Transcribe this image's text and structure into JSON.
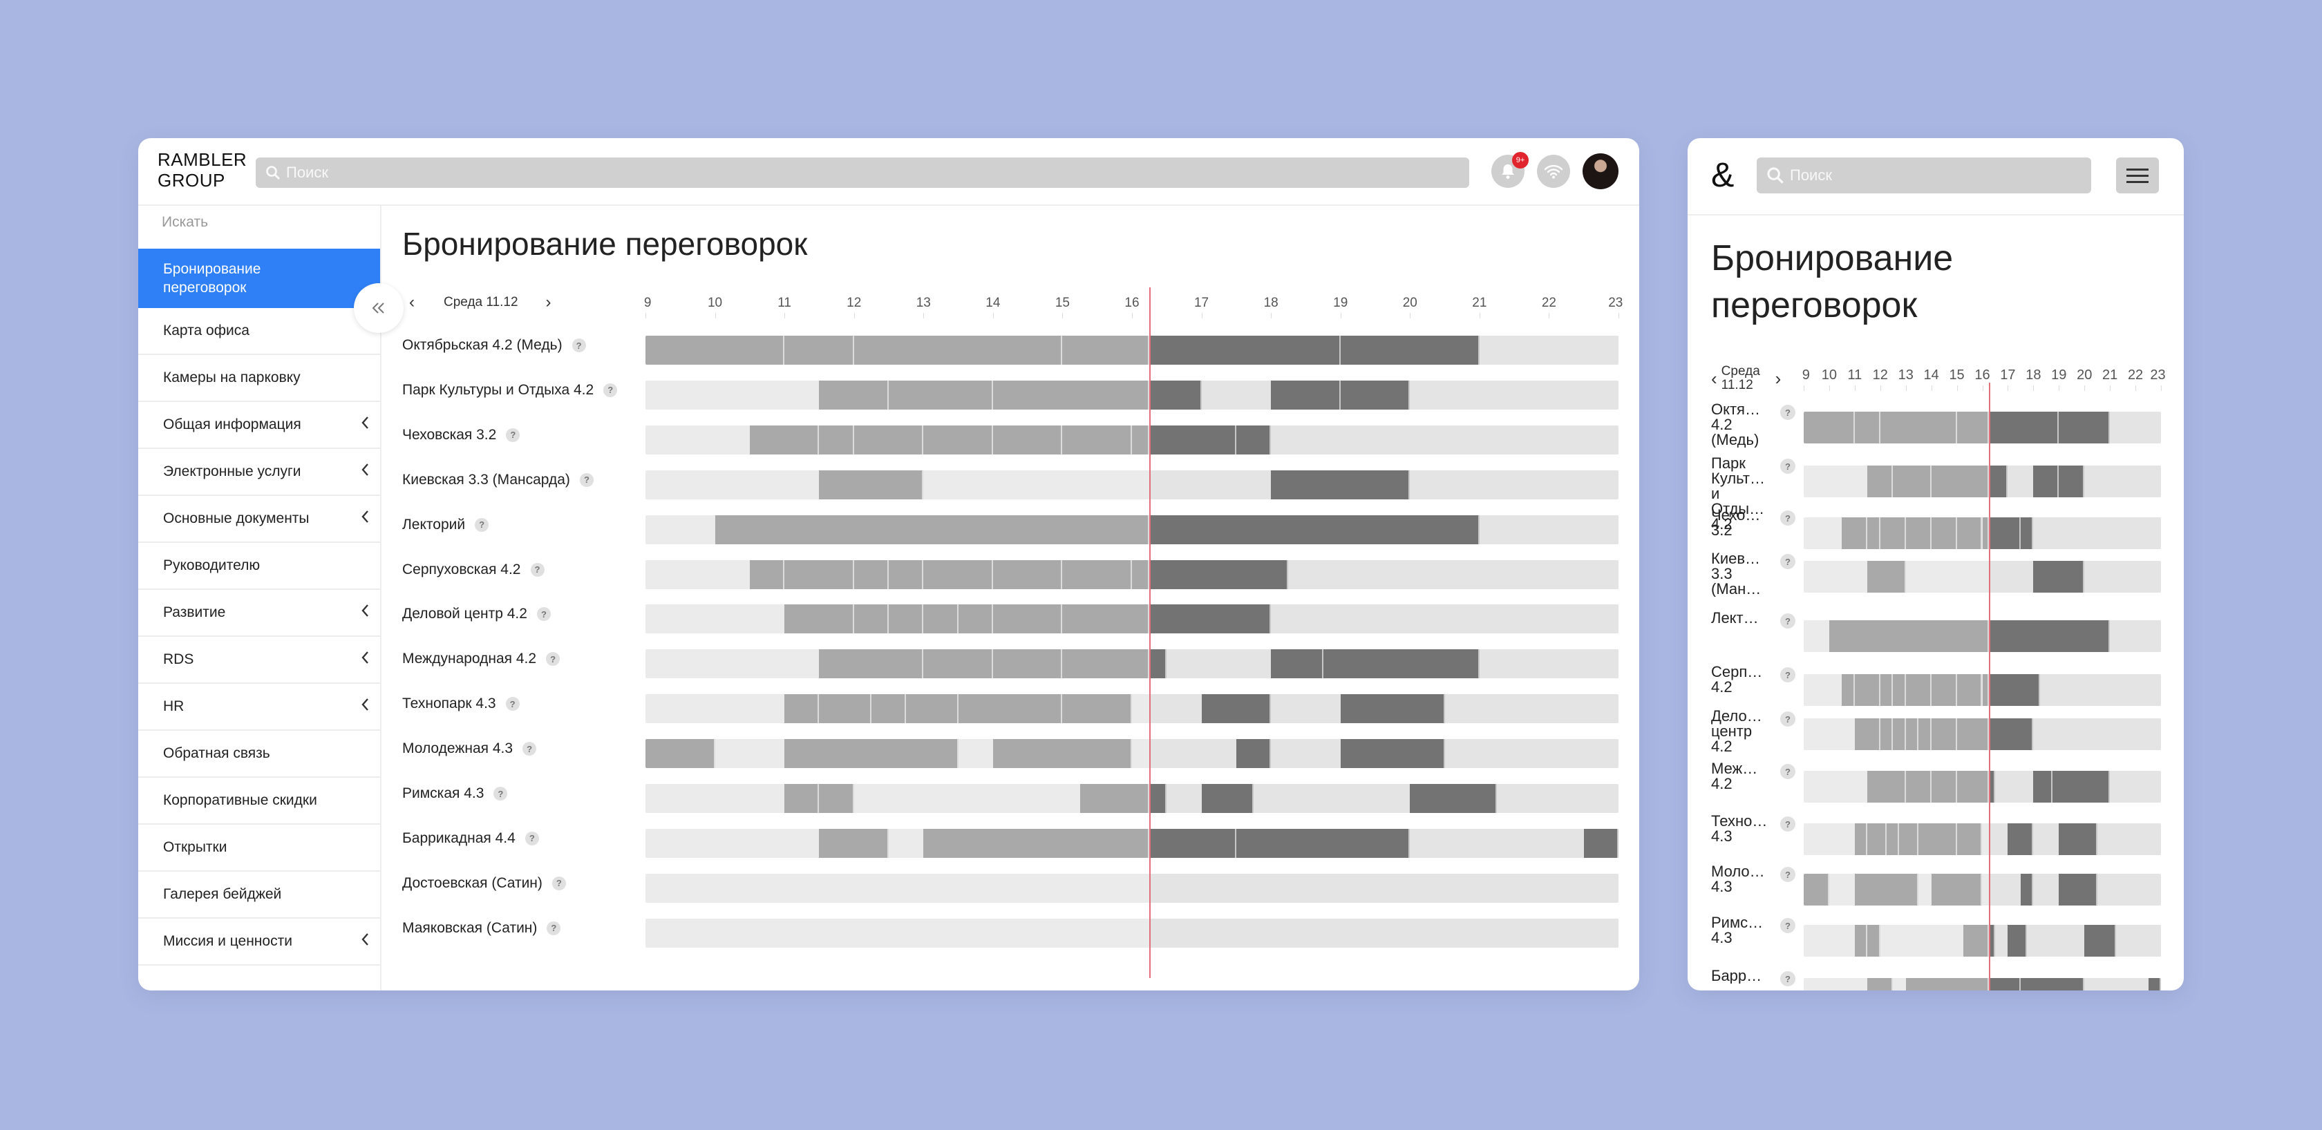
{
  "desktop": {
    "logo": "RAMBLER\nGROUP",
    "search_placeholder": "Поиск",
    "notification_badge": "9+",
    "sidebar_search": "Искать",
    "sidebar_items": [
      {
        "label": "Бронирование переговорок",
        "active": true,
        "expandable": false
      },
      {
        "label": "Карта офиса",
        "active": false,
        "expandable": false
      },
      {
        "label": "Камеры на парковку",
        "active": false,
        "expandable": false
      },
      {
        "label": "Общая информация",
        "active": false,
        "expandable": true
      },
      {
        "label": "Электронные услуги",
        "active": false,
        "expandable": true
      },
      {
        "label": "Основные документы",
        "active": false,
        "expandable": true
      },
      {
        "label": "Руководителю",
        "active": false,
        "expandable": false
      },
      {
        "label": "Развитие",
        "active": false,
        "expandable": true
      },
      {
        "label": "RDS",
        "active": false,
        "expandable": true
      },
      {
        "label": "HR",
        "active": false,
        "expandable": true
      },
      {
        "label": "Обратная связь",
        "active": false,
        "expandable": false
      },
      {
        "label": "Корпоративные скидки",
        "active": false,
        "expandable": false
      },
      {
        "label": "Открытки",
        "active": false,
        "expandable": false
      },
      {
        "label": "Галерея бейджей",
        "active": false,
        "expandable": false
      },
      {
        "label": "Миссия и ценности",
        "active": false,
        "expandable": true
      }
    ],
    "title": "Бронирование переговорок",
    "day_label": "Среда 11.12",
    "help_mark": "?"
  },
  "mobile": {
    "logo": "&",
    "search_placeholder": "Поиск",
    "title": "Бронирование переговорок",
    "day_label": "Среда 11.12",
    "room_labels": [
      "Октя… 4.2 (Медь)",
      "Парк Культ… и Отды… 4.2",
      "Чехо… 3.2",
      "Киев… 3.3 (Ман…",
      "Лект…",
      "Серп… 4.2",
      "Дело… центр 4.2",
      "Меж… 4.2",
      "Техно… 4.3",
      "Моло… 4.3",
      "Римс… 4.3",
      "Барр…"
    ]
  },
  "schedule": {
    "hours": [
      "9",
      "10",
      "11",
      "12",
      "13",
      "14",
      "15",
      "16",
      "17",
      "18",
      "19",
      "20",
      "21",
      "22",
      "23"
    ],
    "hour_start": 9,
    "hour_end": 23,
    "current_time": 16.25,
    "colors": {
      "past_booking": "#a9a9a9",
      "future_booking": "#737373",
      "free_past": "#ececec",
      "free_future": "#e4e4e4",
      "now_line": "#e0707a"
    },
    "rooms": [
      {
        "name": "Октябрьская 4.2 (Медь)",
        "bookings": [
          [
            9,
            11
          ],
          [
            11,
            12
          ],
          [
            12,
            15
          ],
          [
            15,
            16.25
          ],
          [
            16.25,
            19
          ],
          [
            19,
            21
          ]
        ]
      },
      {
        "name": "Парк Культуры и Отдыха 4.2",
        "bookings": [
          [
            11.5,
            12.5
          ],
          [
            12.5,
            14
          ],
          [
            14,
            16.25
          ],
          [
            16.25,
            17
          ],
          [
            18,
            19
          ],
          [
            19,
            20
          ]
        ]
      },
      {
        "name": "Чеховская 3.2",
        "bookings": [
          [
            10.5,
            11.5
          ],
          [
            11.5,
            12
          ],
          [
            12,
            13
          ],
          [
            13,
            14
          ],
          [
            14,
            15
          ],
          [
            15,
            16
          ],
          [
            16,
            16.25
          ],
          [
            16.25,
            17.5
          ],
          [
            17.5,
            18
          ]
        ]
      },
      {
        "name": "Киевская 3.3 (Мансарда)",
        "bookings": [
          [
            11.5,
            13
          ],
          [
            18,
            20
          ]
        ]
      },
      {
        "name": "Лекторий",
        "bookings": [
          [
            10,
            16.25
          ],
          [
            16.25,
            21
          ]
        ]
      },
      {
        "name": "Серпуховская 4.2",
        "bookings": [
          [
            10.5,
            11
          ],
          [
            11,
            12
          ],
          [
            12,
            12.5
          ],
          [
            12.5,
            13
          ],
          [
            13,
            14
          ],
          [
            14,
            15
          ],
          [
            15,
            16
          ],
          [
            16,
            16.25
          ],
          [
            16.25,
            18.25
          ]
        ]
      },
      {
        "name": "Деловой центр 4.2",
        "bookings": [
          [
            11,
            12
          ],
          [
            12,
            12.5
          ],
          [
            12.5,
            13
          ],
          [
            13,
            13.5
          ],
          [
            13.5,
            14
          ],
          [
            14,
            15
          ],
          [
            15,
            16.25
          ],
          [
            16.25,
            18
          ]
        ]
      },
      {
        "name": "Международная 4.2",
        "bookings": [
          [
            11.5,
            13
          ],
          [
            13,
            14
          ],
          [
            14,
            15
          ],
          [
            15,
            16.25
          ],
          [
            16.25,
            16.5
          ],
          [
            18,
            18.75
          ],
          [
            18.75,
            21
          ]
        ]
      },
      {
        "name": "Технопарк 4.3",
        "bookings": [
          [
            11,
            11.5
          ],
          [
            11.5,
            12.25
          ],
          [
            12.25,
            12.75
          ],
          [
            12.75,
            13.5
          ],
          [
            13.5,
            15
          ],
          [
            15,
            16
          ],
          [
            17,
            18
          ],
          [
            19,
            20.5
          ]
        ]
      },
      {
        "name": "Молодежная 4.3",
        "bookings": [
          [
            9,
            10
          ],
          [
            11,
            13.5
          ],
          [
            14,
            16
          ],
          [
            17.5,
            18
          ],
          [
            19,
            20.5
          ]
        ]
      },
      {
        "name": "Римская 4.3",
        "bookings": [
          [
            11,
            11.5
          ],
          [
            11.5,
            12
          ],
          [
            15.25,
            16.25
          ],
          [
            16.25,
            16.5
          ],
          [
            17,
            17.75
          ],
          [
            20,
            21.25
          ]
        ]
      },
      {
        "name": "Баррикадная 4.4",
        "bookings": [
          [
            11.5,
            12.5
          ],
          [
            13,
            16.25
          ],
          [
            16.25,
            17.5
          ],
          [
            17.5,
            20
          ],
          [
            22.5,
            23
          ]
        ]
      },
      {
        "name": "Достоевская (Сатин)",
        "bookings": []
      },
      {
        "name": "Маяковская (Сатин)",
        "bookings": []
      }
    ]
  }
}
